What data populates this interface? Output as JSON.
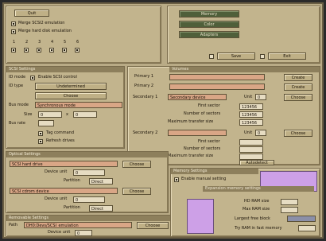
{
  "top_left": {
    "quit_label": "Quit",
    "opt1_label": "Merge SCSI2 emulation",
    "opt2_label": "Merge hard disk emulation",
    "numbers": [
      "1",
      "2",
      "3",
      "4",
      "5",
      "6"
    ]
  },
  "top_right": {
    "buttons": [
      "Memory",
      "Color",
      "Adapters"
    ],
    "save_label": "Save",
    "exit_label": "Exit"
  },
  "io": {
    "title": "SCSI Settings",
    "row1_label": "ID mode",
    "row1_checkbox": "Enable SCSI control",
    "row2_label": "ID type",
    "row2_button": "Undetermined",
    "row3_button": "Choose",
    "row4_label": "Bus mode",
    "row4_value": "Synchronous mode",
    "size_label": "Size",
    "size_value": "0",
    "size_value2": "0",
    "ratio_label": "Bus rate",
    "check_label": "Tag command",
    "check2_label": "Refresh drives"
  },
  "volumes": {
    "title": "Volumes",
    "primary1_label": "Primary 1",
    "primary2_label": "Primary 2",
    "secondary1_label": "Secondary 1",
    "secondary1_value": "Secondary device",
    "secondary2_label": "Secondary 2",
    "create_label": "Create",
    "create2_label": "Create",
    "choose_label": "Choose",
    "choose2_label": "Choose",
    "unit_label": "Unit",
    "unit_value": "0",
    "unit2_label": "Unit",
    "unit2_value": "0",
    "first_sector_label": "First sector",
    "first_sector_value": "123456",
    "num_sectors_label": "Number of sectors",
    "num_sectors_value": "123456",
    "max_transfer_label": "Maximum transfer size",
    "max_transfer_value": "123456",
    "first_sector2_label": "First sector",
    "num_sectors2_label": "Number of sectors",
    "max_transfer2_label": "Maximum transfer size",
    "dropdown_label": "Autodetect"
  },
  "optical": {
    "title": "Optical Settings",
    "device1_value": "SCSI hard drive",
    "device_unit_label": "Device unit",
    "device_unit_value": "0",
    "partition_label": "Partition",
    "partition_value": "Direct",
    "choose_label": "Choose",
    "device2_value": "SCSI cdrom device",
    "device_unit2_label": "Device unit",
    "device_unit2_value": "0",
    "partition2_label": "Partition",
    "partition2_value": "Direct",
    "choose2_label": "Choose"
  },
  "removable": {
    "title": "Removable Settings",
    "path_label": "Path",
    "path_value": "DH0:Devs/SCSI_emulation",
    "choose_label": "Choose",
    "device_unit_label": "Device unit",
    "device_unit_value": "0"
  },
  "memory": {
    "title": "Memory Settings",
    "checkbox_label": "Enable manual setting",
    "sub_title": "Expansion memory settings",
    "hd_ram_label": "HD RAM size",
    "max_ram_label": "Max RAM size",
    "largest_label": "Largest free block",
    "fast_label": "Try RAM in fast memory"
  },
  "colors": {
    "accent": "#cda0e7",
    "field": "#d9a686",
    "panel": "#c2b48d"
  }
}
